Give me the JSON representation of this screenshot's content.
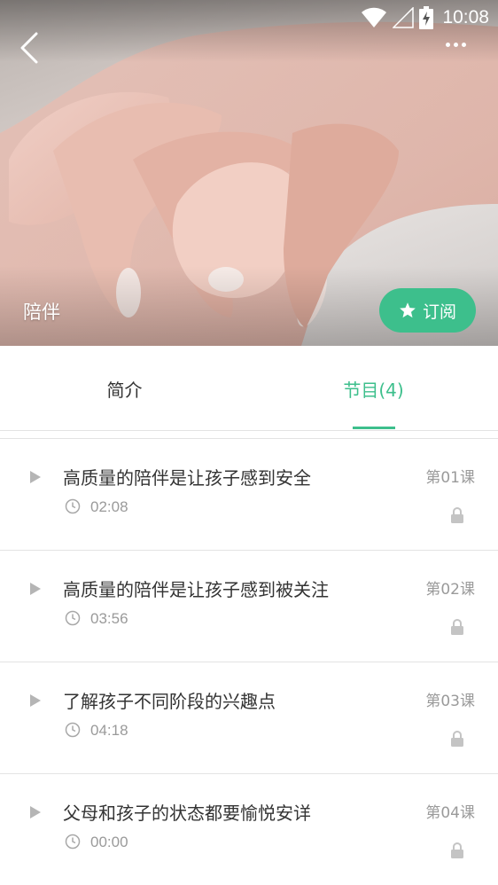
{
  "status_bar": {
    "time": "10:08"
  },
  "header": {
    "title": "陪伴",
    "subscribe_label": "订阅"
  },
  "tabs": [
    {
      "label": "简介",
      "active": false
    },
    {
      "label": "节目(4)",
      "active": true
    }
  ],
  "episodes": [
    {
      "title": "高质量的陪伴是让孩子感到安全",
      "duration": "02:08",
      "lesson": "第01课",
      "locked": true
    },
    {
      "title": "高质量的陪伴是让孩子感到被关注",
      "duration": "03:56",
      "lesson": "第02课",
      "locked": true
    },
    {
      "title": "了解孩子不同阶段的兴趣点",
      "duration": "04:18",
      "lesson": "第03课",
      "locked": true
    },
    {
      "title": "父母和孩子的状态都要愉悦安详",
      "duration": "00:00",
      "lesson": "第04课",
      "locked": true
    }
  ],
  "colors": {
    "accent": "#3dbf8c",
    "text_primary": "#333333",
    "text_secondary": "#9a9a9a"
  },
  "icons": [
    "back-arrow-icon",
    "more-icon",
    "star-icon",
    "play-icon",
    "clock-icon",
    "lock-icon",
    "wifi-icon",
    "signal-icon",
    "battery-icon"
  ]
}
